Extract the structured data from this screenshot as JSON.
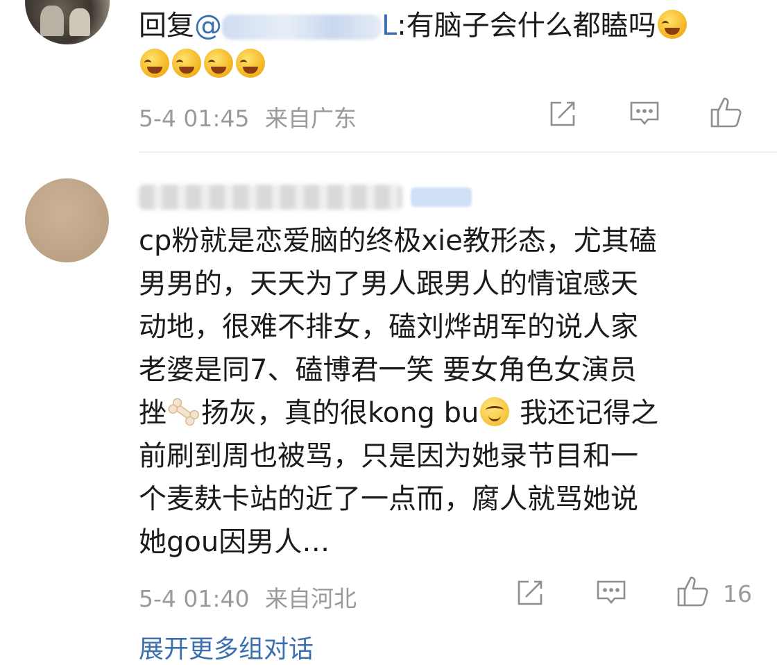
{
  "comment1": {
    "reply_prefix": "回复",
    "mention_at": "@",
    "mention_tail": "L",
    "text_after": ":有脑子会什么都瞌吗",
    "emoji": "laugh-cry-emoji",
    "time": "5-4 01:45",
    "location": "来自广东"
  },
  "comment2": {
    "lines": [
      "cp粉就是恋爱脑的终极xie教形态，尤其磕",
      "男男的，天天为了男人跟男人的情谊感天",
      "动地，很难不排女，磕刘烨胡军的说人家",
      "老婆是同7、磕博君一笑 要女角色女演员"
    ],
    "line5_pre": "挫",
    "line5_mid": "扬灰，真的很kong bu",
    "line5_post": " 我还记得之",
    "lines_after": [
      "前刷到周也被骂，只是因为她录节目和一",
      "个麦麸卡站的近了一点而，腐人就骂她说",
      "她gou因男人…"
    ],
    "time": "5-4 01:40",
    "location": "来自河北",
    "like_count": "16"
  },
  "expand_link": "展开更多组对话",
  "icons": {
    "repost": "repost-icon",
    "comment": "comment-icon",
    "like": "like-icon"
  },
  "colors": {
    "link": "#3a6fb0",
    "meta": "#9a9a9a",
    "text": "#1b1b1b"
  }
}
